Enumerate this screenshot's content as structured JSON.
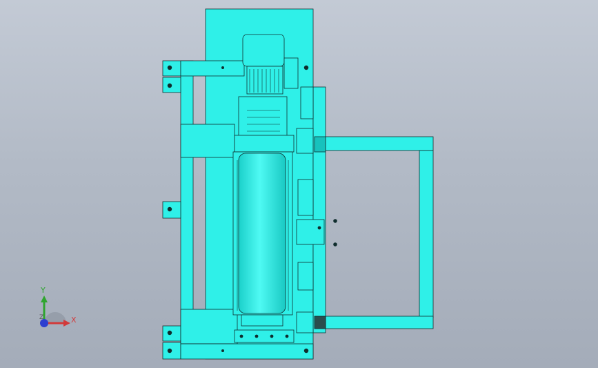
{
  "viewport": {
    "background_top": "#c3cad5",
    "background_bottom": "#a4acb9",
    "part_color": "#2ff0e8",
    "part_shade": "#17c2bd",
    "edge_color": "#0f2d2d"
  },
  "triad": {
    "x_label": "X",
    "y_label": "Y",
    "z_label": "Z",
    "x_color": "#d23a3a",
    "y_color": "#2fa52f",
    "z_color": "#2d3fd0"
  }
}
